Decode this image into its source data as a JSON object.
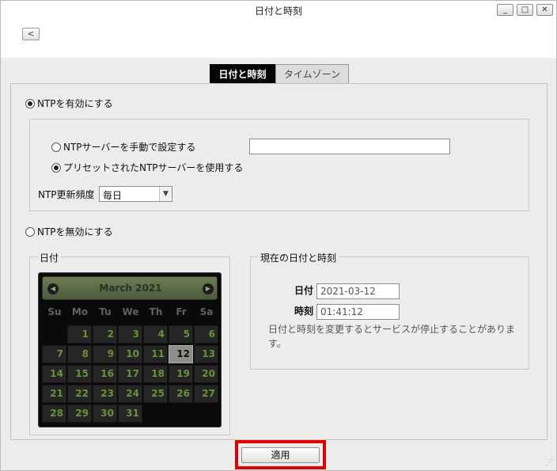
{
  "window": {
    "title": "日付と時刻",
    "controls": {
      "minimize": "_",
      "maximize": "□",
      "close": "✕"
    }
  },
  "toolbar": {
    "back_label": "<"
  },
  "tabs": [
    {
      "label": "日付と時刻",
      "active": true
    },
    {
      "label": "タイムゾーン",
      "active": false
    }
  ],
  "ntp": {
    "enable_label": "NTPを有効にする",
    "enable_selected": true,
    "manual_server_label": "NTPサーバーを手動で設定する",
    "manual_server_selected": false,
    "manual_server_value": "",
    "preset_server_label": "プリセットされたNTPサーバーを使用する",
    "preset_server_selected": true,
    "frequency_label": "NTP更新頻度",
    "frequency_value": "毎日",
    "disable_label": "NTPを無効にする",
    "disable_selected": false
  },
  "date_section": {
    "legend": "日付",
    "calendar": {
      "month_label": "March 2021",
      "prev_icon": "◀",
      "next_icon": "▶",
      "weekdays": [
        "Su",
        "Mo",
        "Tu",
        "We",
        "Th",
        "Fr",
        "Sa"
      ],
      "first_weekday_index": 1,
      "days_in_month": 31,
      "selected_day": 12,
      "days": [
        "1",
        "2",
        "3",
        "4",
        "5",
        "6",
        "7",
        "8",
        "9",
        "10",
        "11",
        "12",
        "13",
        "14",
        "15",
        "16",
        "17",
        "18",
        "19",
        "20",
        "21",
        "22",
        "23",
        "24",
        "25",
        "26",
        "27",
        "28",
        "29",
        "30",
        "31"
      ]
    }
  },
  "current_section": {
    "legend": "現在の日付と時刻",
    "date_label": "日付",
    "date_value": "2021-03-12",
    "time_label": "時刻",
    "time_value": "01:41:12",
    "note": "日付と時刻を変更するとサービスが停止することがあります。"
  },
  "footer": {
    "apply_label": "適用",
    "resize_icon": "⋰"
  },
  "colors": {
    "highlight_border": "#e00000",
    "calendar_day_text": "#6c8f3e",
    "calendar_background": "#0a0a0a"
  }
}
